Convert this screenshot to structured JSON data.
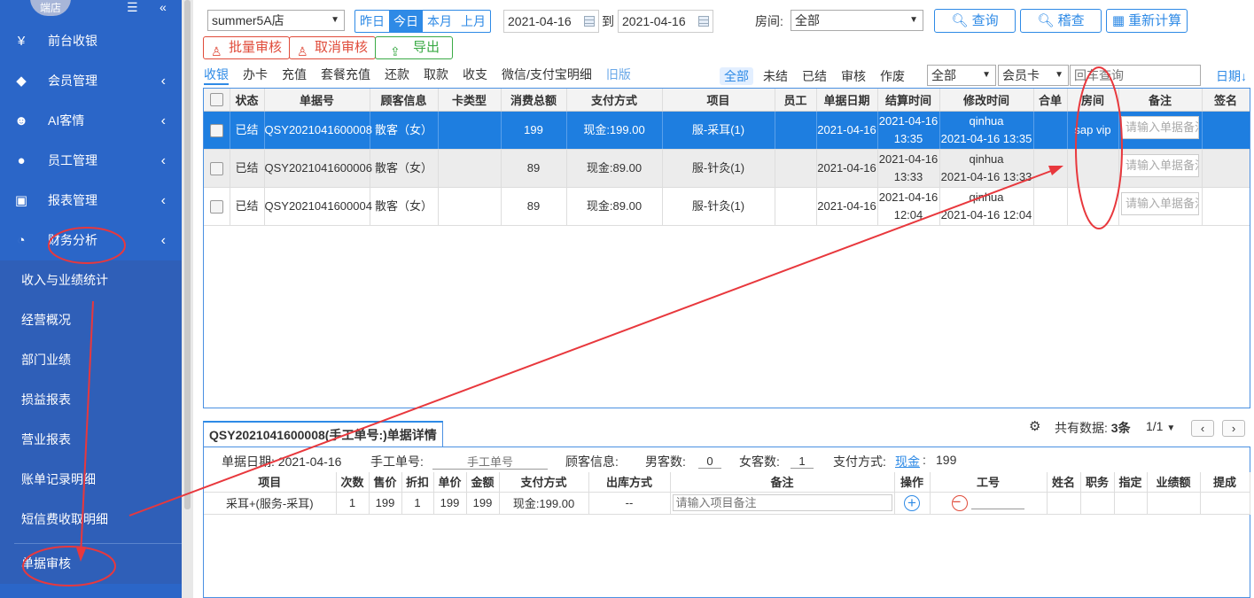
{
  "sidebar": {
    "store_badge": "端店",
    "menu": [
      {
        "label": "前台收银",
        "icon": "yen-icon",
        "glyph": "¥",
        "chevron": false
      },
      {
        "label": "会员管理",
        "icon": "diamond-icon",
        "glyph": "◆",
        "chevron": true
      },
      {
        "label": "AI客情",
        "icon": "user-plus-icon",
        "glyph": "☻",
        "chevron": true
      },
      {
        "label": "员工管理",
        "icon": "user-icon",
        "glyph": "●",
        "chevron": true
      },
      {
        "label": "报表管理",
        "icon": "monitor-icon",
        "glyph": "▣",
        "chevron": true
      },
      {
        "label": "财务分析",
        "icon": "pie-chart-icon",
        "glyph": "◔",
        "chevron": true
      }
    ],
    "submenu": [
      "收入与业绩统计",
      "经营概况",
      "部门业绩",
      "损益报表",
      "营业报表",
      "账单记录明细",
      "短信费收取明细"
    ],
    "after_sep": "单据审核"
  },
  "toolbar": {
    "store_select": "summer5A店",
    "quick_ranges": [
      "昨日",
      "今日",
      "本月",
      "上月"
    ],
    "active_range": "今日",
    "date_from": "2021-04-16",
    "to_label": "到",
    "date_to": "2021-04-16",
    "room_label": "房间:",
    "room_select": "全部",
    "search_btn": "查询",
    "audit_btn": "稽查",
    "recalc_btn": "重新计算",
    "batch_audit_btn": "批量审核",
    "cancel_audit_btn": "取消审核",
    "export_btn": "导出"
  },
  "tabs": {
    "items": [
      "收银",
      "办卡",
      "充值",
      "套餐充值",
      "还款",
      "取款",
      "收支",
      "微信/支付宝明细"
    ],
    "active": "收银",
    "old_version": "旧版"
  },
  "filters": {
    "items": [
      "全部",
      "未结",
      "已结",
      "审核",
      "作废"
    ],
    "active": "全部",
    "status_select": "全部",
    "card_type_select": "会员卡号",
    "search_placeholder": "回车查询",
    "sort_link": "日期↓"
  },
  "grid": {
    "headers": [
      "",
      "状态",
      "单据号",
      "顾客信息",
      "卡类型",
      "消费总额",
      "支付方式",
      "项目",
      "员工",
      "单据日期",
      "结算时间",
      "修改时间",
      "合单",
      "房间",
      "备注",
      "签名"
    ],
    "note_placeholder": "请输入单据备注",
    "rows": [
      {
        "status": "已结",
        "no": "QSY2021041600008",
        "customer": "散客（女）",
        "card": "",
        "total": "199",
        "pay": "现金:199.00",
        "item": "服-采耳(1)",
        "staff": "",
        "date": "2021-04-16",
        "settle_d": "2021-04-16",
        "settle_t": "13:35",
        "mod_by": "qinhua",
        "mod_at": "2021-04-16 13:35",
        "merge": "",
        "room": "sap vip",
        "sign": ""
      },
      {
        "status": "已结",
        "no": "QSY2021041600006",
        "customer": "散客（女）",
        "card": "",
        "total": "89",
        "pay": "现金:89.00",
        "item": "服-针灸(1)",
        "staff": "",
        "date": "2021-04-16",
        "settle_d": "2021-04-16",
        "settle_t": "13:33",
        "mod_by": "qinhua",
        "mod_at": "2021-04-16 13:33",
        "merge": "",
        "room": "",
        "sign": ""
      },
      {
        "status": "已结",
        "no": "QSY2021041600004",
        "customer": "散客（女）",
        "card": "",
        "total": "89",
        "pay": "现金:89.00",
        "item": "服-针灸(1)",
        "staff": "",
        "date": "2021-04-16",
        "settle_d": "2021-04-16",
        "settle_t": "12:04",
        "mod_by": "qinhua",
        "mod_at": "2021-04-16 12:04",
        "merge": "",
        "room": "",
        "sign": ""
      }
    ]
  },
  "detail": {
    "tab_title": "QSY2021041600008(手工单号:)单据详情",
    "total_label": "共有数据:",
    "total_value": "3条",
    "page": "1/1",
    "info": {
      "date_label": "单据日期:",
      "date": "2021-04-16",
      "manual_label": "手工单号:",
      "manual_placeholder": "手工单号",
      "customer_label": "顾客信息:",
      "male_label": "男客数:",
      "male": "0",
      "female_label": "女客数:",
      "female": "1",
      "pay_label": "支付方式:",
      "pay_method": "现金",
      "pay_amount": "199"
    },
    "headers": [
      "项目",
      "次数",
      "售价",
      "折扣",
      "单价",
      "金额",
      "支付方式",
      "出库方式",
      "备注",
      "操作",
      "工号",
      "姓名",
      "职务",
      "指定",
      "业绩额",
      "提成"
    ],
    "row": {
      "item": "采耳+(服务-采耳)",
      "count": "1",
      "price": "199",
      "discount": "1",
      "unit": "199",
      "amount": "199",
      "pay": "现金:199.00",
      "outbound": "--",
      "note_placeholder": "请输入项目备注"
    }
  },
  "colors": {
    "sidebar": "#2b66c8",
    "accent": "#2e8ae6",
    "danger": "#e04b3a",
    "success": "#3aaa45",
    "annotation": "#e8383d"
  }
}
